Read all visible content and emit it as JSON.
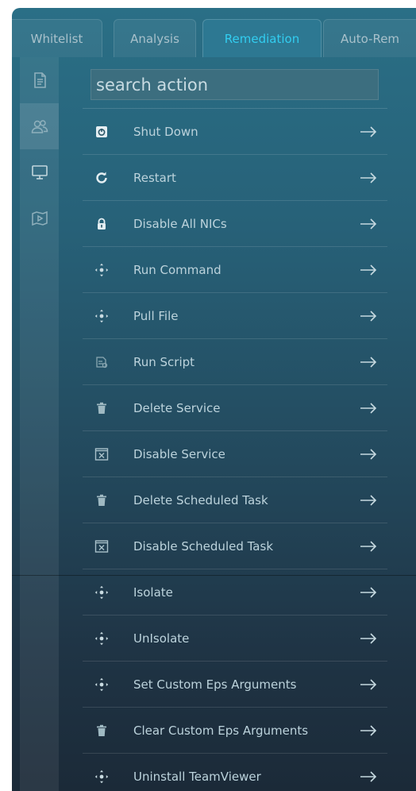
{
  "tabs": [
    {
      "label": "Whitelist",
      "active": false
    },
    {
      "label": "Analysis",
      "active": false
    },
    {
      "label": "Remediation",
      "active": true
    },
    {
      "label": "Auto-Rem",
      "active": false
    }
  ],
  "sidebar_icons": [
    "document-icon",
    "users-icon",
    "monitor-icon",
    "media-icon"
  ],
  "search": {
    "placeholder": "search action"
  },
  "actions": [
    {
      "label": "Shut Down",
      "icon": "power-box-icon"
    },
    {
      "label": "Restart",
      "icon": "restart-icon"
    },
    {
      "label": "Disable All NICs",
      "icon": "lock-icon"
    },
    {
      "label": "Run Command",
      "icon": "move-arrows-icon"
    },
    {
      "label": "Pull File",
      "icon": "move-arrows-icon"
    },
    {
      "label": "Run Script",
      "icon": "script-icon"
    },
    {
      "label": "Delete Service",
      "icon": "trash-icon"
    },
    {
      "label": "Disable Service",
      "icon": "x-box-icon"
    },
    {
      "label": "Delete Scheduled Task",
      "icon": "trash-icon"
    },
    {
      "label": "Disable Scheduled Task",
      "icon": "x-box-icon"
    },
    {
      "label": "Isolate",
      "icon": "move-arrows-icon"
    },
    {
      "label": "UnIsolate",
      "icon": "move-arrows-icon"
    },
    {
      "label": "Set Custom Eps Arguments",
      "icon": "move-arrows-icon"
    },
    {
      "label": "Clear Custom Eps Arguments",
      "icon": "trash-icon"
    },
    {
      "label": "Uninstall TeamViewer",
      "icon": "move-arrows-icon"
    }
  ],
  "colors": {
    "accent": "#32cdf0",
    "text": "#bcd3dc",
    "panel_top": "#2a6f86",
    "panel_bottom": "#1b2a38"
  }
}
